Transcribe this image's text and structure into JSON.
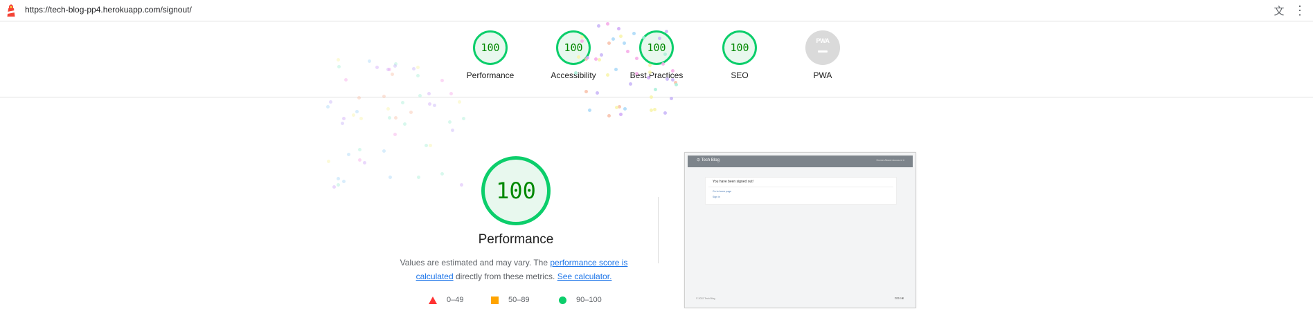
{
  "browser": {
    "url": "https://tech-blog-pp4.herokuapp.com/signout/",
    "translate_icon": "translate-icon",
    "menu_icon": "kebab-menu-icon"
  },
  "gauges": [
    {
      "score": "100",
      "label": "Performance"
    },
    {
      "score": "100",
      "label": "Accessibility"
    },
    {
      "score": "100",
      "label": "Best Practices"
    },
    {
      "score": "100",
      "label": "SEO"
    },
    {
      "score": "PWA",
      "label": "PWA"
    }
  ],
  "performance": {
    "score": "100",
    "title": "Performance",
    "desc_pre": "Values are estimated and may vary. The ",
    "desc_link1": "performance score is calculated",
    "desc_mid": " directly from these metrics. ",
    "desc_link2": "See calculator."
  },
  "legend": {
    "fail": "0–49",
    "average": "50–89",
    "pass": "90–100"
  },
  "colors": {
    "pass": "#0cce6b",
    "average": "#ffa400",
    "fail": "#ff3333",
    "link": "#1a73e8"
  },
  "screenshot": {
    "brand": "Tech Blog",
    "nav": "Home   About   Account ▾",
    "message": "You have been signed out!",
    "link1": "Go to home page",
    "link2": "Sign in",
    "footer": "© 2022 Tech Blog",
    "icons": "⊡⊡⊙⊠"
  }
}
